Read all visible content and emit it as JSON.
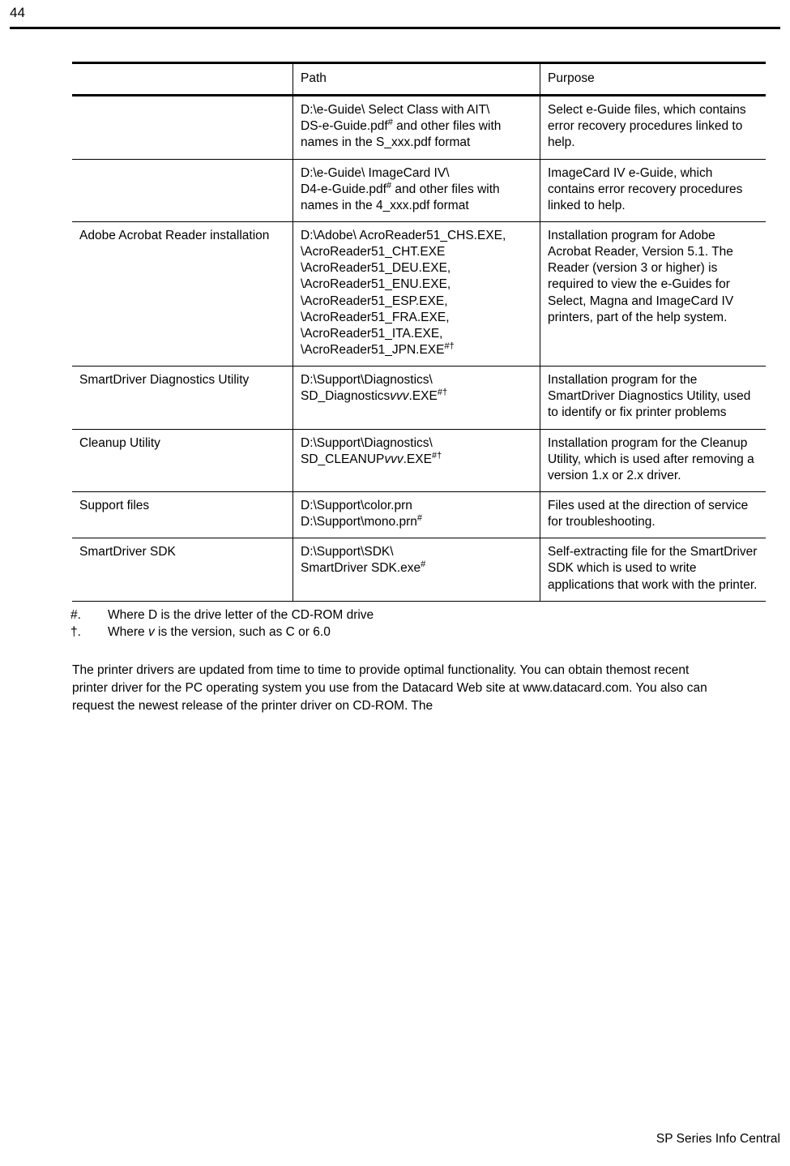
{
  "page": {
    "number": "44",
    "footer": "SP Series Info Central"
  },
  "table": {
    "headers": [
      "",
      "Path",
      "Purpose"
    ],
    "rows": [
      {
        "c1": "",
        "path_lines": [
          "D:\\e-Guide\\ Select Class with AIT\\",
          "DS-e-Guide.pdf# and other files with names in the S_xxx.pdf format"
        ],
        "purpose": "Select e-Guide files, which contains error recovery procedures linked to help."
      },
      {
        "c1": "",
        "path_lines": [
          "D:\\e-Guide\\ ImageCard IV\\",
          "D4-e-Guide.pdf# and other files with names in the 4_xxx.pdf format"
        ],
        "purpose": "ImageCard IV e-Guide, which contains error recovery procedures linked to help."
      },
      {
        "c1": "Adobe Acrobat Reader installation",
        "path_lines": [
          "D:\\Adobe\\ AcroReader51_CHS.EXE, \\AcroReader51_CHT.EXE \\AcroReader51_DEU.EXE, \\AcroReader51_ENU.EXE, \\AcroReader51_ESP.EXE, \\AcroReader51_FRA.EXE, \\AcroReader51_ITA.EXE,",
          "\\AcroReader51_JPN.EXE#†"
        ],
        "purpose": "Installation program for Adobe Acrobat Reader, Version 5.1. The Reader (version 3 or higher) is required to view the e-Guides for Select, Magna and ImageCard IV printers, part of the help system."
      },
      {
        "c1": "SmartDriver Diagnostics Utility",
        "path_lines": [
          "D:\\Support\\Diagnostics\\",
          "SD_Diagnosticsvvv.EXE#†"
        ],
        "purpose": "Installation program for the SmartDriver Diagnostics Utility, used to identify or fix printer problems"
      },
      {
        "c1": "Cleanup Utility",
        "path_lines": [
          "D:\\Support\\Diagnostics\\",
          "SD_CLEANUPvvv.EXE#†"
        ],
        "purpose": "Installation program for the Cleanup Utility, which is used after removing a version 1.x or 2.x driver."
      },
      {
        "c1": "Support files",
        "path_lines": [
          "D:\\Support\\color.prn",
          "D:\\Support\\mono.prn#"
        ],
        "purpose": "Files used at the direction of service for troubleshooting."
      },
      {
        "c1": "SmartDriver SDK",
        "path_lines": [
          "D:\\Support\\SDK\\",
          "SmartDriver SDK.exe#"
        ],
        "purpose": "Self-extracting file for the SmartDriver SDK which is used to write applications that work with the printer."
      }
    ]
  },
  "footnotes": [
    {
      "mark": "#.",
      "text": "Where D is the drive letter of the CD-ROM drive"
    },
    {
      "mark": "†.",
      "text": "Where v is the version, such as C or 6.0"
    }
  ],
  "paragraph": "The printer drivers are updated from time to time to provide optimal functionality. You can obtain themost recent printer driver for the PC operating system you use from the Datacard Web site at www.datacard.com. You also can request the newest release of the printer driver on CD-ROM. The"
}
